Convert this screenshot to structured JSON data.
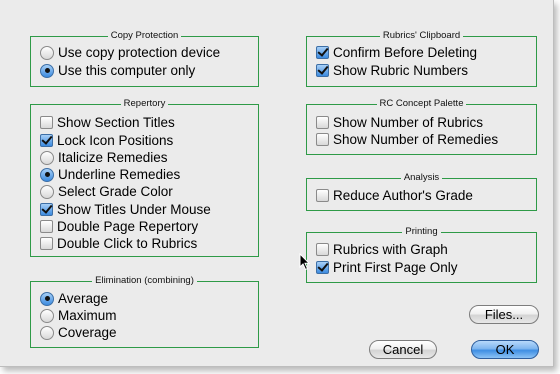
{
  "groups": {
    "copy_protection": {
      "title": "Copy Protection",
      "options": [
        {
          "label": "Use copy protection device",
          "checked": false
        },
        {
          "label": "Use this computer only",
          "checked": true
        }
      ]
    },
    "repertory": {
      "title": "Repertory",
      "items": [
        {
          "label": "Show Section Titles",
          "control": "checkbox",
          "checked": false
        },
        {
          "label": "Lock Icon Positions",
          "control": "checkbox",
          "checked": true
        },
        {
          "label": "Italicize Remedies",
          "control": "radio",
          "checked": false
        },
        {
          "label": "Underline Remedies",
          "control": "radio",
          "checked": true
        },
        {
          "label": "Select Grade Color",
          "control": "radio",
          "checked": false
        },
        {
          "label": "Show Titles Under Mouse",
          "control": "checkbox",
          "checked": true
        },
        {
          "label": "Double Page Repertory",
          "control": "checkbox",
          "checked": false
        },
        {
          "label": "Double Click to Rubrics",
          "control": "checkbox",
          "checked": false
        }
      ]
    },
    "elimination": {
      "title": "Elimination (combining)",
      "options": [
        {
          "label": "Average",
          "checked": true
        },
        {
          "label": "Maximum",
          "checked": false
        },
        {
          "label": "Coverage",
          "checked": false
        }
      ]
    },
    "rubrics_clipboard": {
      "title": "Rubrics' Clipboard",
      "items": [
        {
          "label": "Confirm Before Deleting",
          "checked": true
        },
        {
          "label": "Show Rubric Numbers",
          "checked": true
        }
      ]
    },
    "rc_concept_palette": {
      "title": "RC Concept Palette",
      "items": [
        {
          "label": "Show Number of Rubrics",
          "checked": false
        },
        {
          "label": "Show Number of Remedies",
          "checked": false
        }
      ]
    },
    "analysis": {
      "title": "Analysis",
      "items": [
        {
          "label": "Reduce Author's Grade",
          "checked": false
        }
      ]
    },
    "printing": {
      "title": "Printing",
      "items": [
        {
          "label": "Rubrics with Graph",
          "checked": false
        },
        {
          "label": "Print First Page Only",
          "checked": true
        }
      ]
    }
  },
  "buttons": {
    "files": "Files...",
    "cancel": "Cancel",
    "ok": "OK"
  },
  "colors": {
    "group_border": "#2e9a47",
    "dialog_background": "#ebebeb",
    "checked_control": "#3c8be0"
  }
}
